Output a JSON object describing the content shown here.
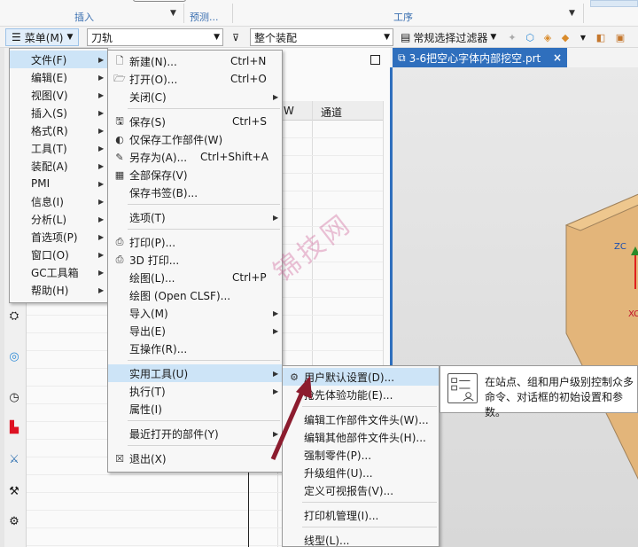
{
  "ribbon": {
    "groups": [
      "插入",
      "预测...",
      "工序"
    ]
  },
  "cmdbar": {
    "menu_label": "菜单(M)",
    "combo1_value": "刀轨",
    "combo2_value": "整个装配",
    "filter_label": "常规选择过滤器"
  },
  "nav": {
    "columns": [
      "W",
      "通道"
    ]
  },
  "doc_tab": {
    "title": "3-6把空心字体内部挖空.prt",
    "close": "×"
  },
  "main_menu": {
    "items": [
      {
        "label": "文件(F)"
      },
      {
        "label": "编辑(E)"
      },
      {
        "label": "视图(V)"
      },
      {
        "label": "插入(S)"
      },
      {
        "label": "格式(R)"
      },
      {
        "label": "工具(T)"
      },
      {
        "label": "装配(A)"
      },
      {
        "label": "PMI"
      },
      {
        "label": "信息(I)"
      },
      {
        "label": "分析(L)"
      },
      {
        "label": "首选项(P)"
      },
      {
        "label": "窗口(O)"
      },
      {
        "label": "GC工具箱"
      },
      {
        "label": "帮助(H)"
      }
    ]
  },
  "file_menu": {
    "items": [
      {
        "label": "新建(N)...",
        "shortcut": "Ctrl+N"
      },
      {
        "label": "打开(O)...",
        "shortcut": "Ctrl+O"
      },
      {
        "label": "关闭(C)",
        "shortcut": ""
      },
      {
        "label": "保存(S)",
        "shortcut": "Ctrl+S"
      },
      {
        "label": "仅保存工作部件(W)",
        "shortcut": ""
      },
      {
        "label": "另存为(A)...",
        "shortcut": "Ctrl+Shift+A"
      },
      {
        "label": "全部保存(V)",
        "shortcut": ""
      },
      {
        "label": "保存书签(B)...",
        "shortcut": ""
      },
      {
        "label": "选项(T)",
        "shortcut": ""
      },
      {
        "label": "打印(P)...",
        "shortcut": ""
      },
      {
        "label": "3D 打印...",
        "shortcut": ""
      },
      {
        "label": "绘图(L)...",
        "shortcut": "Ctrl+P"
      },
      {
        "label": "绘图 (Open CLSF)...",
        "shortcut": ""
      },
      {
        "label": "导入(M)",
        "shortcut": ""
      },
      {
        "label": "导出(E)",
        "shortcut": ""
      },
      {
        "label": "互操作(R)...",
        "shortcut": ""
      },
      {
        "label": "实用工具(U)",
        "shortcut": ""
      },
      {
        "label": "执行(T)",
        "shortcut": ""
      },
      {
        "label": "属性(I)",
        "shortcut": ""
      },
      {
        "label": "最近打开的部件(Y)",
        "shortcut": ""
      },
      {
        "label": "退出(X)",
        "shortcut": ""
      }
    ]
  },
  "util_menu": {
    "items": [
      {
        "label": "用户默认设置(D)..."
      },
      {
        "label": "抢先体验功能(E)..."
      },
      {
        "label": "编辑工作部件文件头(W)..."
      },
      {
        "label": "编辑其他部件文件头(H)..."
      },
      {
        "label": "强制零件(P)..."
      },
      {
        "label": "升级组件(U)..."
      },
      {
        "label": "定义可视报告(V)..."
      },
      {
        "label": "打印机管理(I)..."
      },
      {
        "label": "线型(L)..."
      }
    ]
  },
  "tooltip": {
    "text": "在站点、组和用户级别控制众多命令、对话框的初始设置和参数。"
  },
  "watermark": "锦技网",
  "colors": {
    "accent": "#2f6fbd",
    "highlight": "#cde4f7",
    "part": "#d9a86c"
  }
}
